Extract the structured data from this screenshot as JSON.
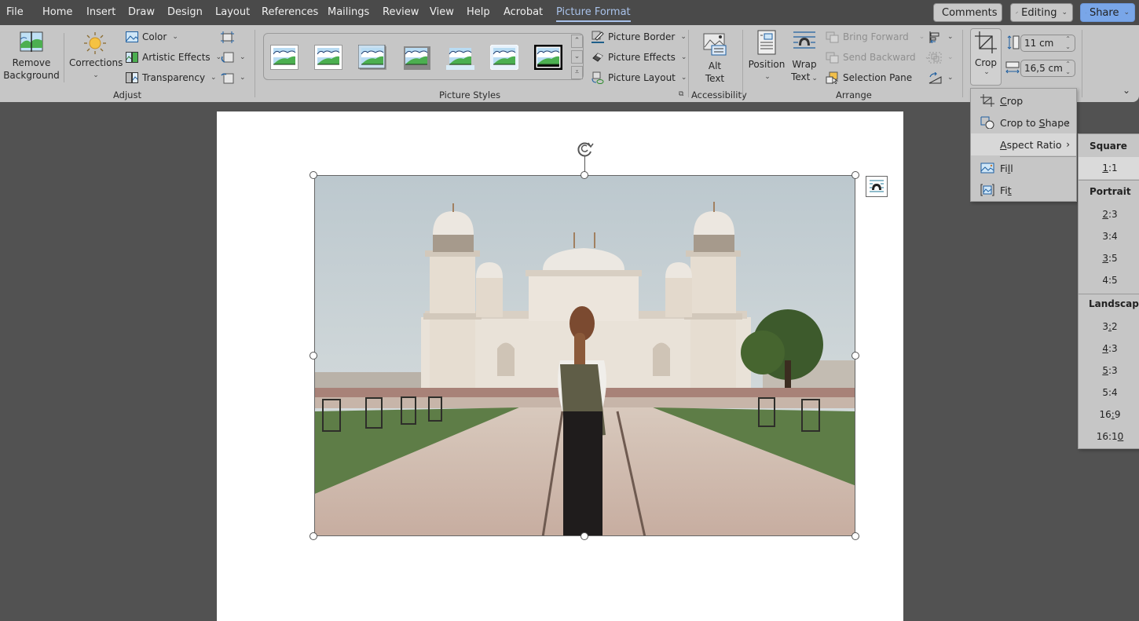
{
  "menubar": {
    "tabs": [
      {
        "label": "File"
      },
      {
        "label": "Home"
      },
      {
        "label": "Insert"
      },
      {
        "label": "Draw"
      },
      {
        "label": "Design"
      },
      {
        "label": "Layout"
      },
      {
        "label": "References"
      },
      {
        "label": "Mailings"
      },
      {
        "label": "Review"
      },
      {
        "label": "View"
      },
      {
        "label": "Help"
      },
      {
        "label": "Acrobat"
      },
      {
        "label": "Picture Format",
        "active": true
      }
    ],
    "comments_label": "Comments",
    "editing_label": "Editing",
    "share_label": "Share"
  },
  "ribbon": {
    "adjust": {
      "remove_background": [
        "Remove",
        "Background"
      ],
      "corrections": "Corrections",
      "color": "Color",
      "artistic_effects": "Artistic Effects",
      "transparency": "Transparency",
      "group_label": "Adjust",
      "extra_icons": [
        "compress-pictures-icon",
        "change-picture-icon",
        "reset-picture-icon"
      ]
    },
    "picture_styles": {
      "gallery_count": 7,
      "picture_border": "Picture Border",
      "picture_effects": "Picture Effects",
      "picture_layout": "Picture Layout",
      "group_label": "Picture Styles"
    },
    "accessibility": {
      "alt_text": [
        "Alt",
        "Text"
      ],
      "group_label": "Accessibility"
    },
    "arrange": {
      "position": "Position",
      "wrap_text": [
        "Wrap",
        "Text"
      ],
      "bring_forward": "Bring Forward",
      "send_backward": "Send Backward",
      "selection_pane": "Selection Pane",
      "group_label": "Arrange"
    },
    "size": {
      "crop": "Crop",
      "height": "11 cm",
      "width": "16,5 cm"
    }
  },
  "crop_menu": {
    "items": [
      {
        "label_pre": "",
        "label_u": "C",
        "label_post": "rop",
        "icon": "crop-icon"
      },
      {
        "label_pre": "Crop to ",
        "label_u": "S",
        "label_post": "hape",
        "icon": "crop-to-shape-icon",
        "submenu": true
      },
      {
        "label_pre": "",
        "label_u": "A",
        "label_post": "spect Ratio",
        "submenu": true,
        "highlighted": true
      },
      {
        "label_pre": "Fi",
        "label_u": "l",
        "label_post": "l",
        "icon": "fill-icon"
      },
      {
        "label_pre": "Fi",
        "label_u": "t",
        "label_post": "",
        "icon": "fit-icon"
      }
    ]
  },
  "aspect_ratio_menu": {
    "sections": [
      {
        "header": "Square",
        "items": [
          {
            "pre": "",
            "u": "1",
            "post": ":1",
            "selected": true
          }
        ]
      },
      {
        "header": "Portrait",
        "items": [
          {
            "pre": "",
            "u": "2",
            "post": ":3"
          },
          {
            "pre": "3:4",
            "u": "",
            "post": ""
          },
          {
            "pre": "",
            "u": "3",
            "post": ":5"
          },
          {
            "pre": "4:5",
            "u": "",
            "post": ""
          }
        ]
      },
      {
        "header": "Landscape",
        "items": [
          {
            "pre": "3",
            "u": ":",
            "post": "2"
          },
          {
            "pre": "",
            "u": "4",
            "post": ":3"
          },
          {
            "pre": "",
            "u": "5",
            "post": ":3"
          },
          {
            "pre": "5:4",
            "u": "",
            "post": ""
          },
          {
            "pre": "16",
            "u": ":",
            "post": "9"
          },
          {
            "pre": "16:1",
            "u": "0",
            "post": ""
          }
        ]
      }
    ]
  },
  "document": {
    "image_alt": "Woman with backpack facing white marble mausoleum with minarets and garden pathway"
  },
  "colors": {
    "menubar_bg": "#4a4a4a",
    "ribbon_bg": "#c6c6c6",
    "active_tab": "#a9c2ea",
    "share_btn": "#79a6e8",
    "canvas_bg": "#525252"
  }
}
